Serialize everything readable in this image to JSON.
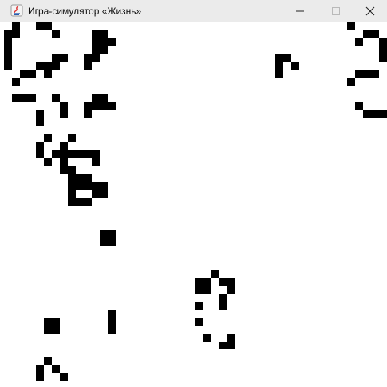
{
  "window": {
    "title": "Игра-симулятор «Жизнь»",
    "icon": "java-app-icon",
    "controls": {
      "minimize": "minimize-icon",
      "maximize": "maximize-icon",
      "close": "close-icon"
    }
  },
  "colors": {
    "titlebar_bg": "#ebebeb",
    "board_bg": "#ffffff",
    "alive_cell": "#000000",
    "maximize_disabled": "#b9b9b9"
  },
  "board": {
    "alive_cells": [
      [
        1,
        0
      ],
      [
        4,
        0
      ],
      [
        5,
        0
      ],
      [
        43,
        0
      ],
      [
        0,
        1
      ],
      [
        1,
        1
      ],
      [
        6,
        1
      ],
      [
        11,
        1
      ],
      [
        12,
        1
      ],
      [
        46,
        1
      ],
      [
        45,
        1
      ],
      [
        0,
        2
      ],
      [
        11,
        2
      ],
      [
        12,
        2
      ],
      [
        13,
        2
      ],
      [
        44,
        2
      ],
      [
        47,
        2
      ],
      [
        0,
        3
      ],
      [
        11,
        3
      ],
      [
        12,
        3
      ],
      [
        47,
        3
      ],
      [
        0,
        4
      ],
      [
        6,
        4
      ],
      [
        7,
        4
      ],
      [
        10,
        4
      ],
      [
        11,
        4
      ],
      [
        34,
        4
      ],
      [
        35,
        4
      ],
      [
        47,
        4
      ],
      [
        0,
        5
      ],
      [
        4,
        5
      ],
      [
        5,
        5
      ],
      [
        6,
        5
      ],
      [
        10,
        5
      ],
      [
        34,
        5
      ],
      [
        36,
        5
      ],
      [
        2,
        6
      ],
      [
        3,
        6
      ],
      [
        5,
        6
      ],
      [
        34,
        6
      ],
      [
        44,
        6
      ],
      [
        45,
        6
      ],
      [
        46,
        6
      ],
      [
        1,
        7
      ],
      [
        43,
        7
      ],
      [
        1,
        9
      ],
      [
        2,
        9
      ],
      [
        3,
        9
      ],
      [
        6,
        9
      ],
      [
        11,
        9
      ],
      [
        12,
        9
      ],
      [
        7,
        10
      ],
      [
        10,
        10
      ],
      [
        11,
        10
      ],
      [
        12,
        10
      ],
      [
        13,
        10
      ],
      [
        44,
        10
      ],
      [
        4,
        11
      ],
      [
        7,
        11
      ],
      [
        10,
        11
      ],
      [
        45,
        11
      ],
      [
        46,
        11
      ],
      [
        47,
        11
      ],
      [
        48,
        11
      ],
      [
        4,
        12
      ],
      [
        5,
        14
      ],
      [
        8,
        14
      ],
      [
        4,
        15
      ],
      [
        7,
        15
      ],
      [
        4,
        16
      ],
      [
        6,
        16
      ],
      [
        7,
        16
      ],
      [
        8,
        16
      ],
      [
        9,
        16
      ],
      [
        10,
        16
      ],
      [
        11,
        16
      ],
      [
        5,
        17
      ],
      [
        7,
        17
      ],
      [
        11,
        17
      ],
      [
        7,
        18
      ],
      [
        8,
        18
      ],
      [
        8,
        19
      ],
      [
        9,
        19
      ],
      [
        10,
        19
      ],
      [
        8,
        20
      ],
      [
        9,
        20
      ],
      [
        10,
        20
      ],
      [
        11,
        20
      ],
      [
        12,
        20
      ],
      [
        8,
        21
      ],
      [
        11,
        21
      ],
      [
        12,
        21
      ],
      [
        8,
        22
      ],
      [
        9,
        22
      ],
      [
        10,
        22
      ],
      [
        12,
        26
      ],
      [
        13,
        26
      ],
      [
        12,
        27
      ],
      [
        13,
        27
      ],
      [
        26,
        31
      ],
      [
        24,
        32
      ],
      [
        25,
        32
      ],
      [
        27,
        32
      ],
      [
        28,
        32
      ],
      [
        24,
        33
      ],
      [
        25,
        33
      ],
      [
        28,
        33
      ],
      [
        27,
        34
      ],
      [
        24,
        35
      ],
      [
        27,
        35
      ],
      [
        13,
        36
      ],
      [
        5,
        37
      ],
      [
        6,
        37
      ],
      [
        13,
        37
      ],
      [
        24,
        37
      ],
      [
        5,
        38
      ],
      [
        6,
        38
      ],
      [
        13,
        38
      ],
      [
        25,
        39
      ],
      [
        28,
        39
      ],
      [
        27,
        40
      ],
      [
        28,
        40
      ],
      [
        5,
        42
      ],
      [
        4,
        43
      ],
      [
        6,
        43
      ],
      [
        4,
        44
      ],
      [
        7,
        44
      ],
      [
        5,
        45
      ],
      [
        6,
        45
      ]
    ]
  }
}
